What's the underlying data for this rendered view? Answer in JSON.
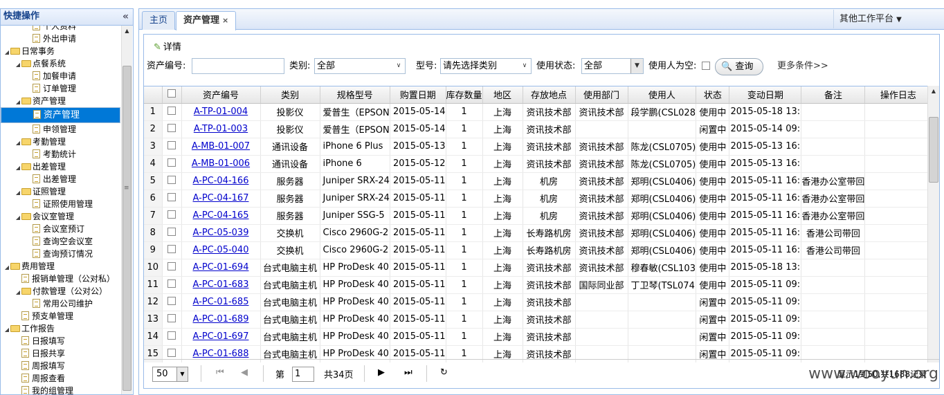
{
  "sidebar": {
    "title": "快捷操作",
    "collapse_glyph": "«",
    "tree": [
      {
        "label": "个人资料",
        "level": 2,
        "kind": "doc"
      },
      {
        "label": "外出申请",
        "level": 2,
        "kind": "doc"
      },
      {
        "label": "日常事务",
        "level": 0,
        "kind": "folder"
      },
      {
        "label": "点餐系统",
        "level": 1,
        "kind": "folder"
      },
      {
        "label": "加餐申请",
        "level": 2,
        "kind": "doc"
      },
      {
        "label": "订单管理",
        "level": 2,
        "kind": "doc"
      },
      {
        "label": "资产管理",
        "level": 1,
        "kind": "folder"
      },
      {
        "label": "资产管理",
        "level": 2,
        "kind": "doc",
        "selected": true
      },
      {
        "label": "申领管理",
        "level": 2,
        "kind": "doc"
      },
      {
        "label": "考勤管理",
        "level": 1,
        "kind": "folder"
      },
      {
        "label": "考勤统计",
        "level": 2,
        "kind": "doc"
      },
      {
        "label": "出差管理",
        "level": 1,
        "kind": "folder"
      },
      {
        "label": "出差管理",
        "level": 2,
        "kind": "doc"
      },
      {
        "label": "证照管理",
        "level": 1,
        "kind": "folder"
      },
      {
        "label": "证照使用管理",
        "level": 2,
        "kind": "doc"
      },
      {
        "label": "会议室管理",
        "level": 1,
        "kind": "folder"
      },
      {
        "label": "会议室预订",
        "level": 2,
        "kind": "doc"
      },
      {
        "label": "查询空会议室",
        "level": 2,
        "kind": "doc"
      },
      {
        "label": "查询预订情况",
        "level": 2,
        "kind": "doc"
      },
      {
        "label": "费用管理",
        "level": 0,
        "kind": "folder"
      },
      {
        "label": "报销单管理（公对私）",
        "level": 1,
        "kind": "doc"
      },
      {
        "label": "付款管理（公对公）",
        "level": 1,
        "kind": "folder"
      },
      {
        "label": "常用公司维护",
        "level": 2,
        "kind": "doc"
      },
      {
        "label": "预支单管理",
        "level": 1,
        "kind": "doc"
      },
      {
        "label": "工作报告",
        "level": 0,
        "kind": "folder"
      },
      {
        "label": "日报填写",
        "level": 1,
        "kind": "doc"
      },
      {
        "label": "日报共享",
        "level": 1,
        "kind": "doc"
      },
      {
        "label": "周报填写",
        "level": 1,
        "kind": "doc"
      },
      {
        "label": "周报查看",
        "level": 1,
        "kind": "doc"
      },
      {
        "label": "我的组管理",
        "level": 1,
        "kind": "doc"
      }
    ]
  },
  "tabs": [
    {
      "label": "主页"
    },
    {
      "label": "资产管理",
      "close": "×"
    }
  ],
  "platform": {
    "label": "其他工作平台",
    "arrow": "▼"
  },
  "toolbar": {
    "detail_label": "详情"
  },
  "search": {
    "asset_no_label": "资产编号:",
    "asset_no_value": "",
    "category_label": "类别:",
    "category_value": "全部",
    "model_label": "型号:",
    "model_value": "请先选择类别",
    "status_label": "使用状态:",
    "status_value": "全部",
    "user_empty_label": "使用人为空:",
    "query_label": "查询",
    "more_label": "更多条件>>"
  },
  "table": {
    "columns": [
      "",
      "资产编号",
      "类别",
      "规格型号",
      "购置日期",
      "库存数量",
      "地区",
      "存放地点",
      "使用部门",
      "使用人",
      "状态",
      "变动日期",
      "备注",
      "操作日志"
    ],
    "rows": [
      [
        "1",
        "A-TP-01-004",
        "投影仪",
        "爱普生（EPSON",
        "2015-05-14",
        "1",
        "上海",
        "资讯技术部",
        "资讯技术部",
        "段学鹏(CSL028",
        "使用中",
        "2015-05-18 13:",
        ""
      ],
      [
        "2",
        "A-TP-01-003",
        "投影仪",
        "爱普生（EPSON",
        "2015-05-14",
        "1",
        "上海",
        "资讯技术部",
        "",
        "",
        "闲置中",
        "2015-05-14 09:",
        ""
      ],
      [
        "3",
        "A-MB-01-007",
        "通讯设备",
        "iPhone 6 Plus",
        "2015-05-13",
        "1",
        "上海",
        "资讯技术部",
        "资讯技术部",
        "陈龙(CSL0705)",
        "使用中",
        "2015-05-13 16:",
        ""
      ],
      [
        "4",
        "A-MB-01-006",
        "通讯设备",
        "iPhone 6",
        "2015-05-12",
        "1",
        "上海",
        "资讯技术部",
        "资讯技术部",
        "陈龙(CSL0705)",
        "使用中",
        "2015-05-13 16:",
        ""
      ],
      [
        "5",
        "A-PC-04-166",
        "服务器",
        "Juniper SRX-24",
        "2015-05-11",
        "1",
        "上海",
        "机房",
        "资讯技术部",
        "郑明(CSL0406)",
        "使用中",
        "2015-05-11 16:",
        "香港办公室带回"
      ],
      [
        "6",
        "A-PC-04-167",
        "服务器",
        "Juniper SRX-24",
        "2015-05-11",
        "1",
        "上海",
        "机房",
        "资讯技术部",
        "郑明(CSL0406)",
        "使用中",
        "2015-05-11 16:",
        "香港办公室带回"
      ],
      [
        "7",
        "A-PC-04-165",
        "服务器",
        "Juniper SSG-5",
        "2015-05-11",
        "1",
        "上海",
        "机房",
        "资讯技术部",
        "郑明(CSL0406)",
        "使用中",
        "2015-05-11 16:",
        "香港办公室带回"
      ],
      [
        "8",
        "A-PC-05-039",
        "交换机",
        "Cisco 2960G-2",
        "2015-05-11",
        "1",
        "上海",
        "长寿路机房",
        "资讯技术部",
        "郑明(CSL0406)",
        "使用中",
        "2015-05-11 16:",
        "香港公司带回"
      ],
      [
        "9",
        "A-PC-05-040",
        "交换机",
        "Cisco 2960G-2",
        "2015-05-11",
        "1",
        "上海",
        "长寿路机房",
        "资讯技术部",
        "郑明(CSL0406)",
        "使用中",
        "2015-05-11 16:",
        "香港公司带回"
      ],
      [
        "10",
        "A-PC-01-694",
        "台式电脑主机",
        "HP ProDesk 40",
        "2015-05-11",
        "1",
        "上海",
        "资讯技术部",
        "资讯技术部",
        "穆春敏(CSL103",
        "使用中",
        "2015-05-18 13:",
        ""
      ],
      [
        "11",
        "A-PC-01-683",
        "台式电脑主机",
        "HP ProDesk 40",
        "2015-05-11",
        "1",
        "上海",
        "资讯技术部",
        "国际同业部",
        "丁卫琴(TSL074",
        "使用中",
        "2015-05-11 09:",
        ""
      ],
      [
        "12",
        "A-PC-01-685",
        "台式电脑主机",
        "HP ProDesk 40",
        "2015-05-11",
        "1",
        "上海",
        "资讯技术部",
        "",
        "",
        "闲置中",
        "2015-05-11 09:",
        ""
      ],
      [
        "13",
        "A-PC-01-689",
        "台式电脑主机",
        "HP ProDesk 40",
        "2015-05-11",
        "1",
        "上海",
        "资讯技术部",
        "",
        "",
        "闲置中",
        "2015-05-11 09:",
        ""
      ],
      [
        "14",
        "A-PC-01-697",
        "台式电脑主机",
        "HP ProDesk 40",
        "2015-05-11",
        "1",
        "上海",
        "资讯技术部",
        "",
        "",
        "闲置中",
        "2015-05-11 09:",
        ""
      ],
      [
        "15",
        "A-PC-01-688",
        "台式电脑主机",
        "HP ProDesk 40",
        "2015-05-11",
        "1",
        "上海",
        "资讯技术部",
        "",
        "",
        "闲置中",
        "2015-05-11 09:",
        ""
      ]
    ]
  },
  "pager": {
    "page_size": "50",
    "page_label": "第",
    "page_value": "1",
    "total_pages": "共34页",
    "summary": "显示1到50,共1688记录"
  },
  "watermark": "www.wooyun.org",
  "colors": {
    "accent": "#0078d7",
    "border": "#99bbe8",
    "link": "#0000cc"
  }
}
